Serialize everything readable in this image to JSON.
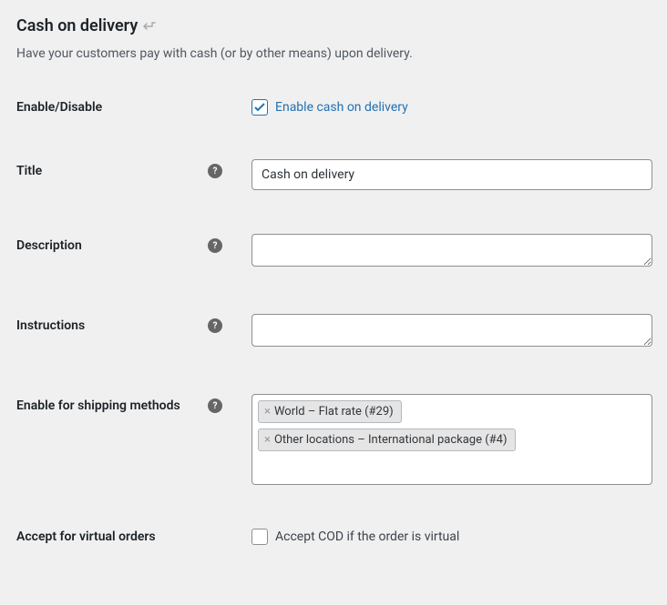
{
  "header": {
    "title": "Cash on delivery",
    "description": "Have your customers pay with cash (or by other means) upon delivery."
  },
  "fields": {
    "enable": {
      "label": "Enable/Disable",
      "checkbox_label": "Enable cash on delivery",
      "checked": true
    },
    "title": {
      "label": "Title",
      "value": "Cash on delivery"
    },
    "description": {
      "label": "Description",
      "value": ""
    },
    "instructions": {
      "label": "Instructions",
      "value": ""
    },
    "shipping_methods": {
      "label": "Enable for shipping methods",
      "tags": [
        "World – Flat rate (#29)",
        "Other locations – International package (#4)"
      ]
    },
    "virtual": {
      "label": "Accept for virtual orders",
      "checkbox_label": "Accept COD if the order is virtual",
      "checked": false
    }
  }
}
